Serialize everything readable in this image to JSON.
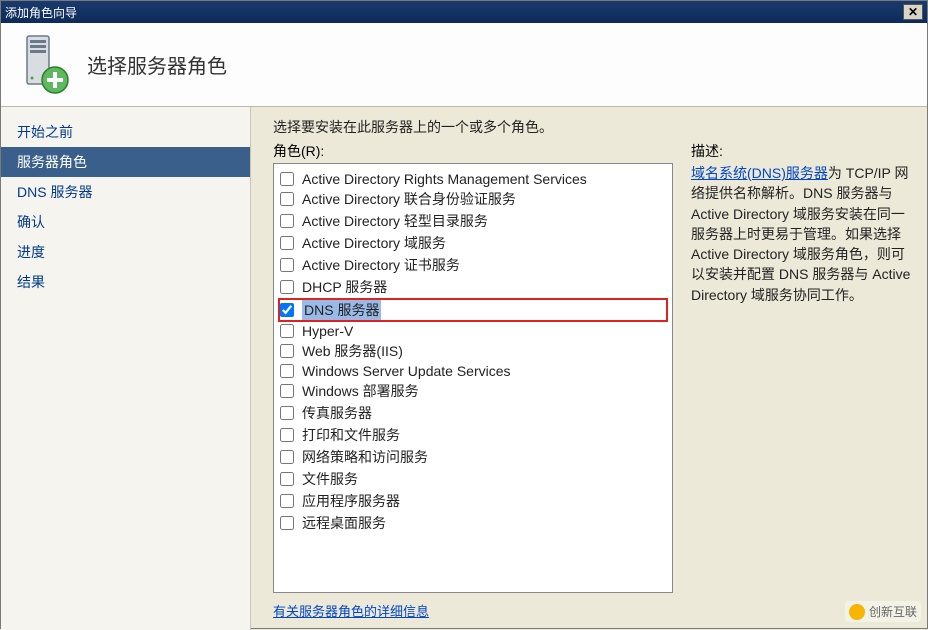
{
  "titlebar": {
    "title": "添加角色向导"
  },
  "header": {
    "title": "选择服务器角色"
  },
  "sidebar": {
    "items": [
      {
        "label": "开始之前",
        "active": false
      },
      {
        "label": "服务器角色",
        "active": true
      },
      {
        "label": "DNS 服务器",
        "active": false
      },
      {
        "label": "确认",
        "active": false
      },
      {
        "label": "进度",
        "active": false
      },
      {
        "label": "结果",
        "active": false
      }
    ]
  },
  "main": {
    "instruction": "选择要安装在此服务器上的一个或多个角色。",
    "roles_heading": "角色(R):",
    "details_link": "有关服务器角色的详细信息",
    "desc_heading": "描述:",
    "desc_link": "域名系统(DNS)服务器",
    "desc_rest": "为 TCP/IP 网络提供名称解析。DNS 服务器与 Active Directory 域服务安装在同一服务器上时更易于管理。如果选择 Active Directory 域服务角色，则可以安装并配置 DNS 服务器与 Active Directory 域服务协同工作。",
    "roles": [
      {
        "label": "Active Directory Rights Management Services",
        "checked": false,
        "highlight": false
      },
      {
        "label": "Active Directory 联合身份验证服务",
        "checked": false,
        "highlight": false
      },
      {
        "label": "Active Directory 轻型目录服务",
        "checked": false,
        "highlight": false
      },
      {
        "label": "Active Directory 域服务",
        "checked": false,
        "highlight": false
      },
      {
        "label": "Active Directory 证书服务",
        "checked": false,
        "highlight": false
      },
      {
        "label": "DHCP 服务器",
        "checked": false,
        "highlight": false
      },
      {
        "label": "DNS 服务器",
        "checked": true,
        "highlight": true
      },
      {
        "label": "Hyper-V",
        "checked": false,
        "highlight": false
      },
      {
        "label": "Web 服务器(IIS)",
        "checked": false,
        "highlight": false
      },
      {
        "label": "Windows Server Update Services",
        "checked": false,
        "highlight": false
      },
      {
        "label": "Windows 部署服务",
        "checked": false,
        "highlight": false
      },
      {
        "label": "传真服务器",
        "checked": false,
        "highlight": false
      },
      {
        "label": "打印和文件服务",
        "checked": false,
        "highlight": false
      },
      {
        "label": "网络策略和访问服务",
        "checked": false,
        "highlight": false
      },
      {
        "label": "文件服务",
        "checked": false,
        "highlight": false
      },
      {
        "label": "应用程序服务器",
        "checked": false,
        "highlight": false
      },
      {
        "label": "远程桌面服务",
        "checked": false,
        "highlight": false
      }
    ]
  },
  "watermark": {
    "text": "创新互联"
  }
}
